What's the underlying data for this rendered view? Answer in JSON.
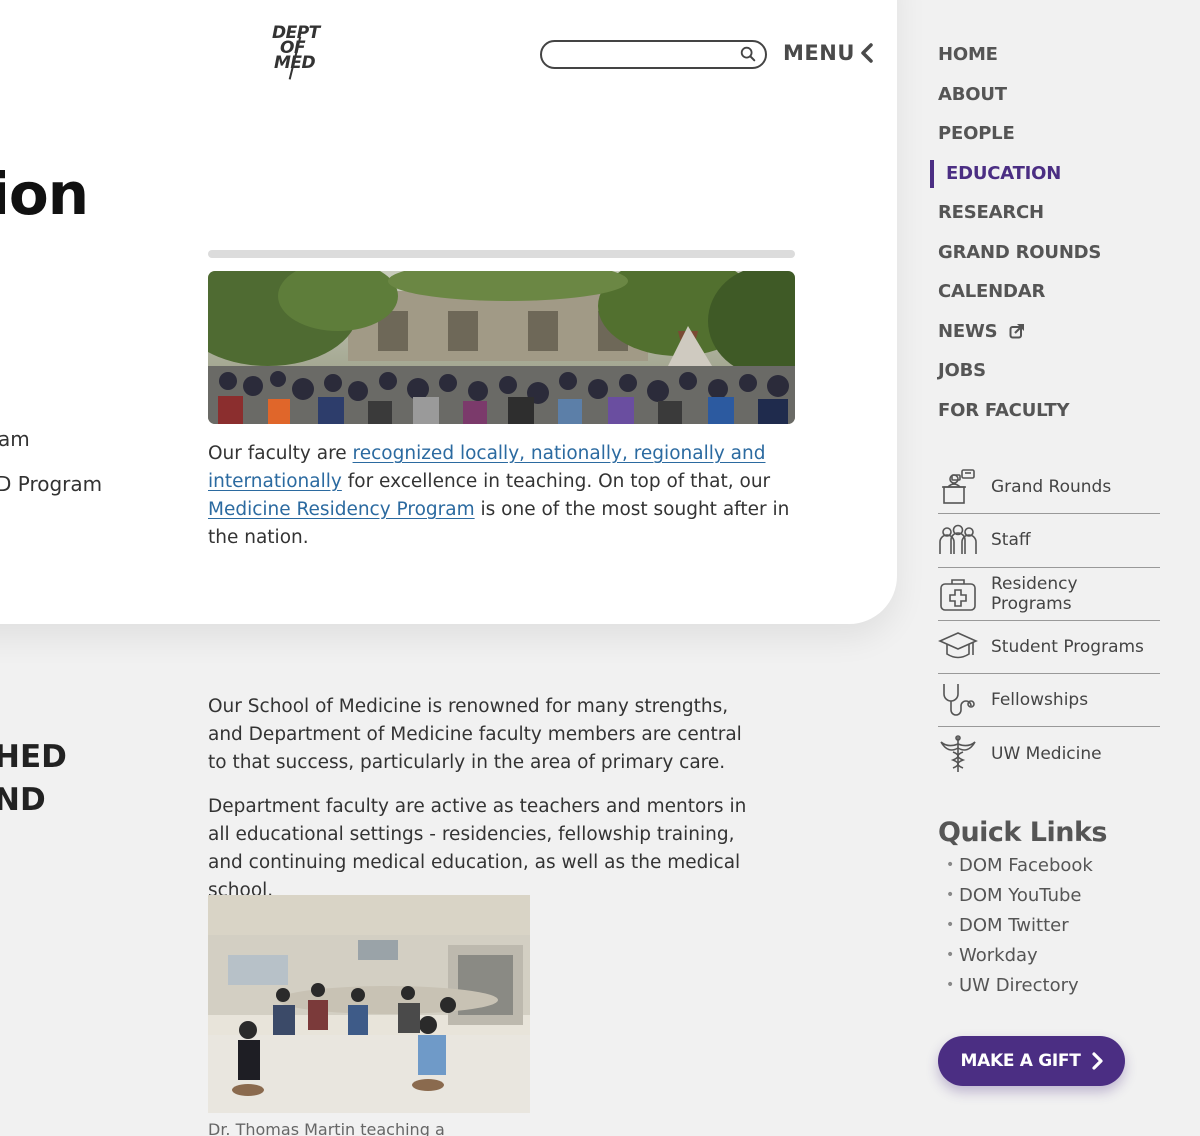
{
  "header": {
    "logo_lines": [
      "DEPT",
      "OF",
      "MED"
    ],
    "search_placeholder": "",
    "menu_label": "MENU"
  },
  "hero": {
    "title_fragment": "ion"
  },
  "left_truncated": {
    "line1": "am",
    "line2": "D Program",
    "heading1": "HED",
    "heading2": "ND"
  },
  "intro": {
    "t1": "Our faculty are ",
    "link1": "recognized locally, nationally, regionally and internationally",
    "t2": " for excellence in teaching. On top of that, our ",
    "link2": "Medicine Residency Program",
    "t3": " is one of the most sought after in the nation."
  },
  "body": {
    "para1": "Our School of Medicine is renowned for many strengths, and Department of Medicine faculty members are central to that success, particularly in the area of primary care.",
    "para2": "Department faculty are active as teachers and mentors in all educational settings - residencies, fellowship training, and continuing medical education, as well as the medical school.",
    "caption": "Dr. Thomas Martin teaching a"
  },
  "nav": {
    "items": [
      {
        "label": "HOME"
      },
      {
        "label": "ABOUT"
      },
      {
        "label": "PEOPLE"
      },
      {
        "label": "EDUCATION"
      },
      {
        "label": "RESEARCH"
      },
      {
        "label": "GRAND ROUNDS"
      },
      {
        "label": "CALENDAR"
      },
      {
        "label": "NEWS"
      },
      {
        "label": "JOBS"
      },
      {
        "label": "FOR FACULTY"
      }
    ],
    "active": "EDUCATION"
  },
  "section_links": [
    {
      "label": "Grand Rounds",
      "icon": "podium-icon"
    },
    {
      "label": "Staff",
      "icon": "people-group-icon"
    },
    {
      "label": "Residency Programs",
      "icon": "medical-kit-icon"
    },
    {
      "label": "Student Programs",
      "icon": "graduation-cap-icon"
    },
    {
      "label": "Fellowships",
      "icon": "stethoscope-icon"
    },
    {
      "label": "UW Medicine",
      "icon": "caduceus-icon"
    }
  ],
  "quick_links": {
    "title": "Quick Links",
    "items": [
      "DOM Facebook",
      "DOM YouTube",
      "DOM Twitter",
      "Workday",
      "UW Directory"
    ]
  },
  "gift": {
    "label": "MAKE A GIFT"
  },
  "colors": {
    "brand_purple": "#4b2e83",
    "link_blue": "#2b6aa0",
    "nav_gray": "#555555",
    "page_bg": "#f1f1f1"
  }
}
